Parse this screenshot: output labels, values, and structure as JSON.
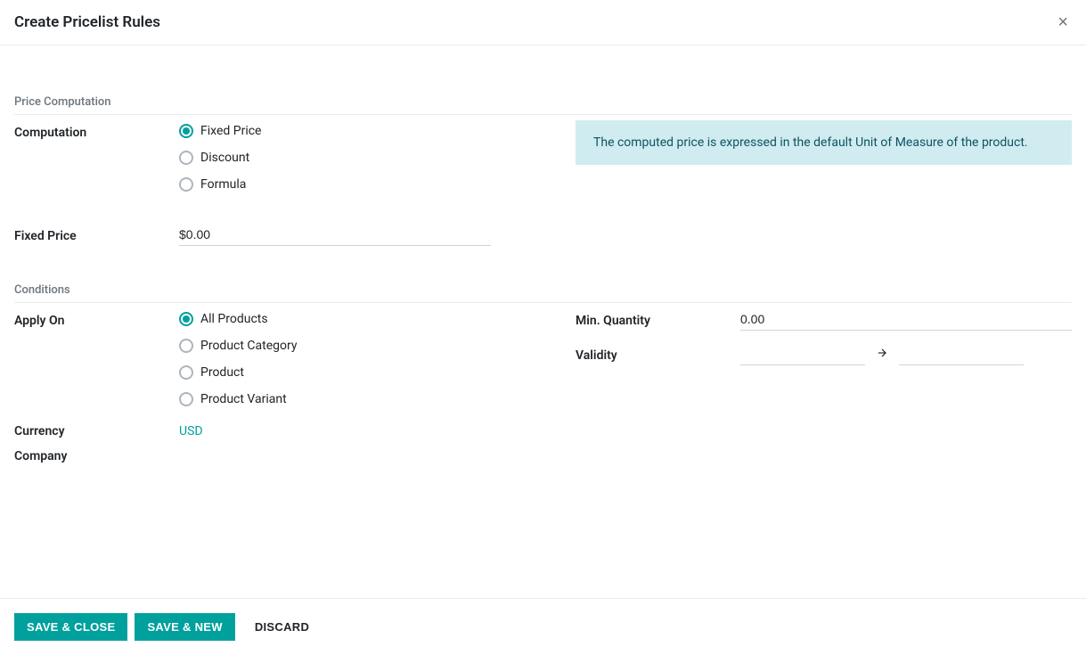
{
  "header": {
    "title": "Create Pricelist Rules"
  },
  "sections": {
    "price_computation": "Price Computation",
    "conditions": "Conditions"
  },
  "labels": {
    "computation": "Computation",
    "fixed_price": "Fixed Price",
    "apply_on": "Apply On",
    "min_quantity": "Min. Quantity",
    "validity": "Validity",
    "currency": "Currency",
    "company": "Company"
  },
  "computation_options": {
    "fixed_price": "Fixed Price",
    "discount": "Discount",
    "formula": "Formula"
  },
  "apply_on_options": {
    "all_products": "All Products",
    "product_category": "Product Category",
    "product": "Product",
    "product_variant": "Product Variant"
  },
  "values": {
    "fixed_price": "$0.00",
    "min_quantity": "0.00",
    "currency": "USD",
    "validity_start": "",
    "validity_end": "",
    "company": ""
  },
  "info_message": "The computed price is expressed in the default Unit of Measure of the product.",
  "buttons": {
    "save_close": "Save & Close",
    "save_new": "Save & New",
    "discard": "Discard"
  }
}
